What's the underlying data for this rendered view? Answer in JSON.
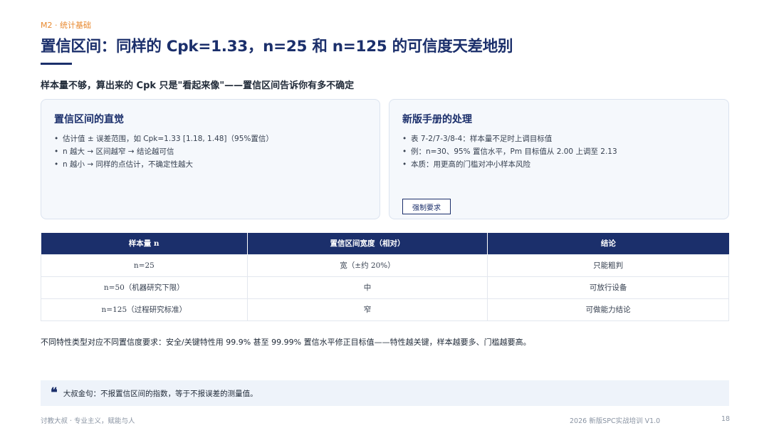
{
  "header": {
    "section": "M2 · 统计基础",
    "title": "置信区间：同样的 Cpk=1.33，n=25 和 n=125 的可信度天差地别",
    "subtitle": "样本量不够，算出来的 Cpk 只是\"看起来像\"——置信区间告诉你有多不确定"
  },
  "cards": {
    "left": {
      "title": "置信区间的直觉",
      "items": [
        "估计值 ± 误差范围，如 Cpk=1.33 [1.18, 1.48]（95%置信）",
        "n 越大 → 区间越窄 → 结论越可信",
        "n 越小 → 同样的点估计，不确定性越大"
      ]
    },
    "right": {
      "title": "新版手册的处理",
      "items": [
        "表 7-2/7-3/8-4：样本量不足时上调目标值",
        "例：n=30、95% 置信水平，Pm 目标值从 2.00 上调至 2.13",
        "本质：用更高的门槛对冲小样本风险"
      ],
      "tag": "强制要求"
    }
  },
  "table": {
    "headers": [
      "样本量 n",
      "置信区间宽度（相对）",
      "结论"
    ],
    "rows": [
      [
        "n=25",
        "宽（±约 20%）",
        "只能粗判"
      ],
      [
        "n=50（机器研究下限）",
        "中",
        "可放行设备"
      ],
      [
        "n=125（过程研究标准）",
        "窄",
        "可做能力结论"
      ]
    ]
  },
  "note": "不同特性类型对应不同置信度要求：安全/关键特性用 99.9% 甚至 99.99% 置信水平修正目标值——特性越关键，样本越要多、门槛越要高。",
  "quote": {
    "icon": "quote-mark-icon",
    "mark": "❝",
    "text": "大叔金句：不报置信区间的指数，等于不报误差的测量值。"
  },
  "footer": {
    "left": "讨教大叔 · 专业主义，赋能与人",
    "right": "2026 新版SPC实战培训 V1.0",
    "page": "18"
  },
  "colors": {
    "primary": "#1b2f6b",
    "accent": "#e8892f",
    "card_bg": "#f5f8fc"
  }
}
